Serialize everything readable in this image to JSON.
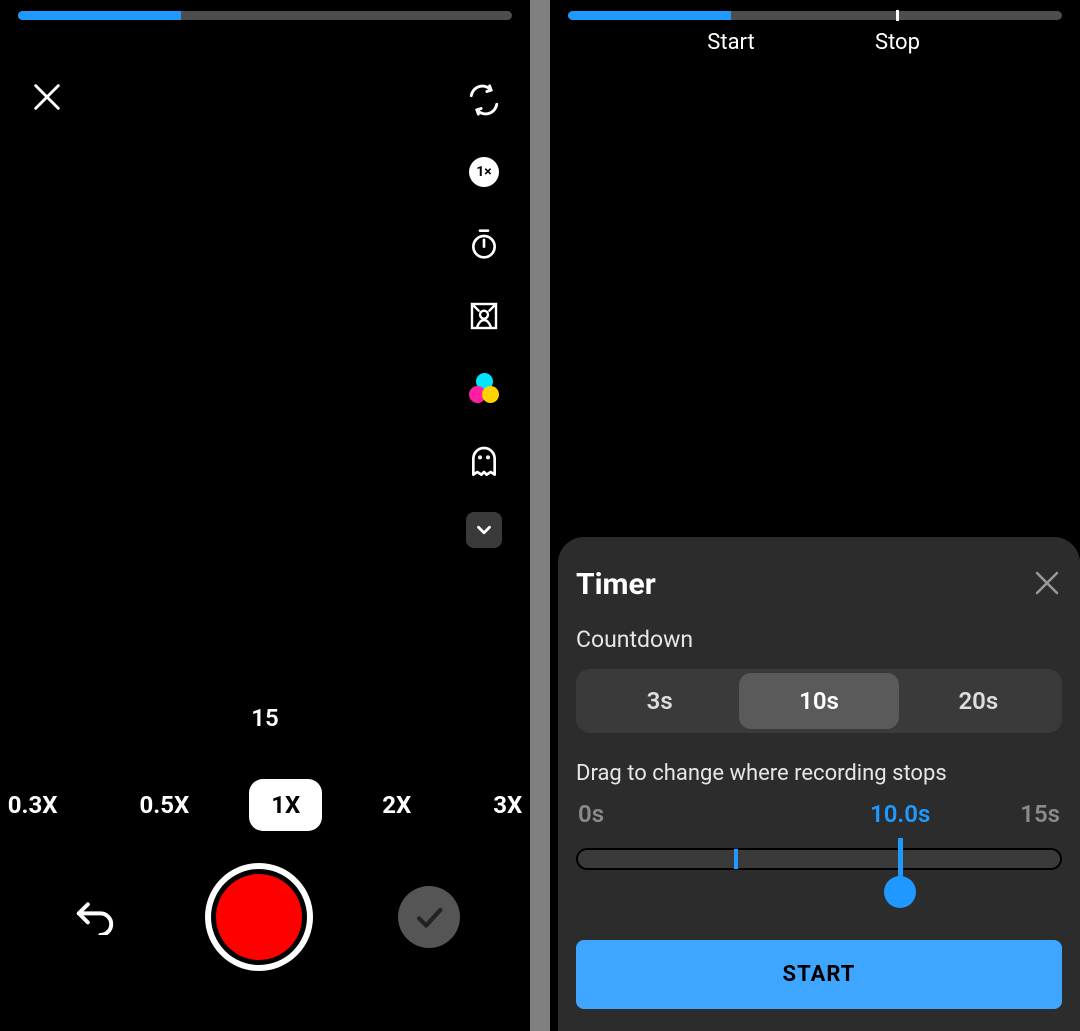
{
  "colors": {
    "accent": "#1f99ff",
    "record": "#ff0000"
  },
  "left": {
    "progress_pct": 33,
    "time_remaining": "15",
    "tools": {
      "speed_badge": "1×"
    },
    "speeds": [
      "0.3X",
      "0.5X",
      "1X",
      "2X",
      "3X"
    ],
    "speed_active_index": 2
  },
  "right": {
    "progress_pct": 33,
    "stop_marker_pct": 66.7,
    "start_label": "Start",
    "stop_label": "Stop",
    "sheet": {
      "title": "Timer",
      "countdown_label": "Countdown",
      "countdown_options": [
        "3s",
        "10s",
        "20s"
      ],
      "countdown_active_index": 1,
      "drag_label": "Drag to change where recording stops",
      "range_min": "0s",
      "range_max": "15s",
      "current_value": "10.0s",
      "current_pct": 66.7,
      "start_tick_pct": 33,
      "start_button": "START"
    }
  }
}
